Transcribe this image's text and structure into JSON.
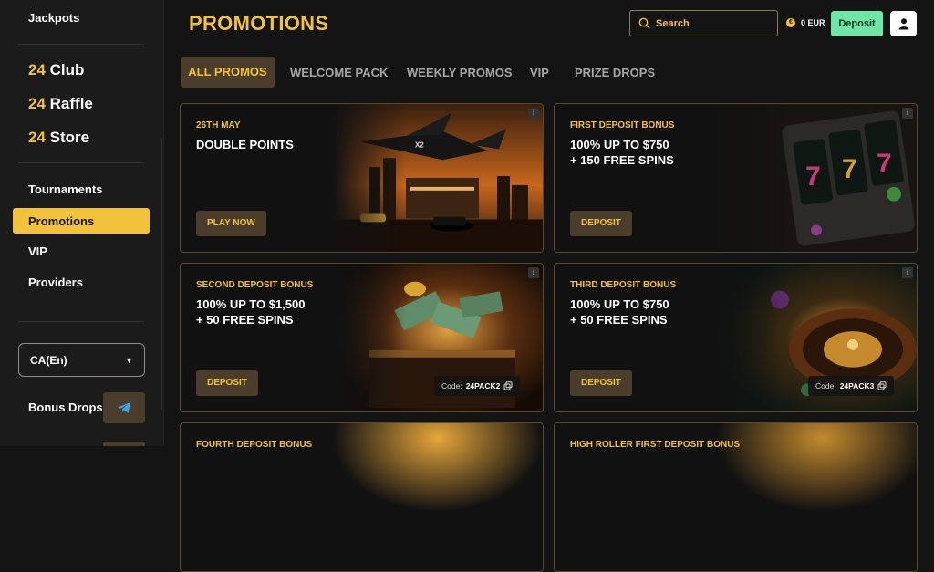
{
  "sidebar": {
    "jackpots": "Jackpots",
    "club": {
      "num": "24",
      "label": "Club"
    },
    "raffle": {
      "num": "24",
      "label": "Raffle"
    },
    "store": {
      "num": "24",
      "label": "Store"
    },
    "items": [
      "Tournaments",
      "Promotions",
      "VIP",
      "Providers"
    ],
    "language": "CA(En)",
    "bonus_drops": "Bonus Drops"
  },
  "header": {
    "title": "PROMOTIONS",
    "search_placeholder": "Search",
    "balance": "0 EUR",
    "coin_symbol": "€",
    "deposit": "Deposit"
  },
  "tabs": [
    "ALL PROMOS",
    "WELCOME PACK",
    "WEEKLY PROMOS",
    "VIP",
    "PRIZE DROPS"
  ],
  "cards": [
    {
      "eyebrow": "26TH MAY",
      "line1": "DOUBLE POINTS",
      "line2": "",
      "cta": "PLAY NOW",
      "code_label": "",
      "code": ""
    },
    {
      "eyebrow": "FIRST DEPOSIT BONUS",
      "line1": "100% UP TO $750",
      "line2": "+ 150 FREE SPINS",
      "cta": "DEPOSIT",
      "code_label": "",
      "code": ""
    },
    {
      "eyebrow": "SECOND DEPOSIT BONUS",
      "line1": "100% UP TO $1,500",
      "line2": "+ 50 FREE SPINS",
      "cta": "DEPOSIT",
      "code_label": "Code:",
      "code": "24PACK2"
    },
    {
      "eyebrow": "THIRD DEPOSIT BONUS",
      "line1": "100% UP TO $750",
      "line2": "+ 50 FREE SPINS",
      "cta": "DEPOSIT",
      "code_label": "Code:",
      "code": "24PACK3"
    },
    {
      "eyebrow": "FOURTH DEPOSIT BONUS"
    },
    {
      "eyebrow": "HIGH ROLLER FIRST DEPOSIT BONUS"
    }
  ],
  "info_icon": "i",
  "colors": {
    "accent": "#f2c23a",
    "deposit_green": "#6ee6a5",
    "button_brown": "#4a3d2c"
  }
}
